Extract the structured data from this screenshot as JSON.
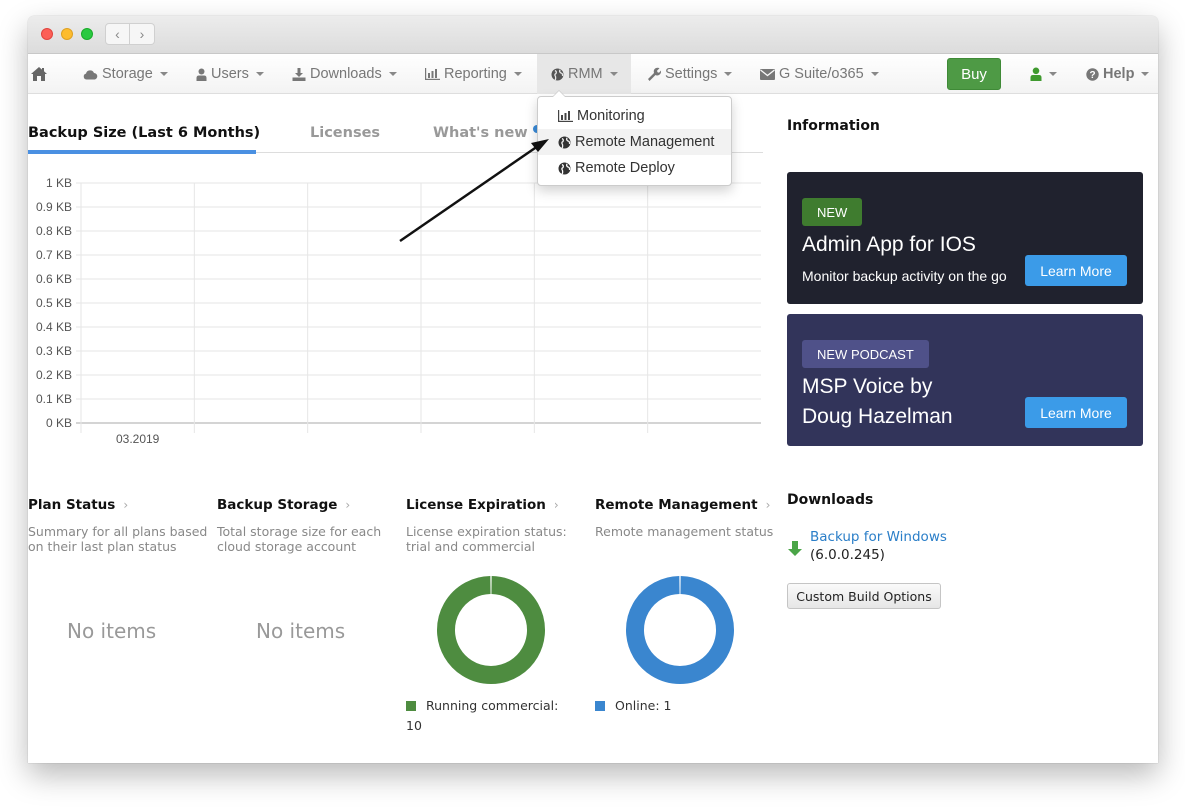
{
  "window": {
    "controls": [
      "close",
      "minimize",
      "maximize"
    ],
    "back_icon": "‹",
    "forward_icon": "›"
  },
  "nav": {
    "home_icon": "home-icon",
    "items": [
      {
        "label": "Storage",
        "icon": "cloud-icon"
      },
      {
        "label": "Users",
        "icon": "user-icon"
      },
      {
        "label": "Downloads",
        "icon": "download-icon"
      },
      {
        "label": "Reporting",
        "icon": "bar-chart-icon"
      },
      {
        "label": "RMM",
        "icon": "globe-icon",
        "active": true
      },
      {
        "label": "Settings",
        "icon": "wrench-icon"
      },
      {
        "label": "G Suite/o365",
        "icon": "envelope-icon"
      }
    ],
    "buy_label": "Buy",
    "account_icon": "user-icon",
    "help_label": "Help",
    "colors": {
      "buy": "#4e9a45",
      "account": "#3f9a2f"
    }
  },
  "rmm_dropdown": {
    "items": [
      {
        "label": "Monitoring",
        "icon": "bar-chart-icon"
      },
      {
        "label": "Remote Management",
        "icon": "globe-icon",
        "highlighted": true
      },
      {
        "label": "Remote Deploy",
        "icon": "globe-icon"
      }
    ]
  },
  "tabs": [
    {
      "label": "Backup Size (Last 6 Months)",
      "active": true
    },
    {
      "label": "Licenses",
      "active": false
    },
    {
      "label": "What's new",
      "active": false,
      "has_dot": true
    }
  ],
  "chart_data": {
    "type": "bar",
    "title": "Backup Size (Last 6 Months)",
    "xlabel": "",
    "ylabel": "",
    "categories": [
      "03.2019",
      "",
      "",
      "",
      "",
      ""
    ],
    "values": [
      0,
      0,
      0,
      0,
      0,
      0
    ],
    "ylim": [
      0,
      1
    ],
    "yunit": "KB",
    "yticks": [
      "0 KB",
      "0.1 KB",
      "0.2 KB",
      "0.3 KB",
      "0.4 KB",
      "0.5 KB",
      "0.6 KB",
      "0.7 KB",
      "0.8 KB",
      "0.9 KB",
      "1 KB"
    ],
    "grid": true
  },
  "widgets": [
    {
      "title": "Plan Status",
      "desc": "Summary for all plans based on their last plan status",
      "empty_text": "No items"
    },
    {
      "title": "Backup Storage",
      "desc": "Total storage size for each cloud storage account",
      "empty_text": "No items"
    },
    {
      "title": "License Expiration",
      "desc": "License expiration status: trial and commercial",
      "donut": {
        "type": "pie",
        "slices": [
          {
            "label": "Running commercial",
            "value": 10,
            "color": "#4e8c40"
          }
        ]
      },
      "legend": "Running commercial:",
      "legend_value": "10"
    },
    {
      "title": "Remote Management",
      "desc": "Remote management status",
      "donut": {
        "type": "pie",
        "slices": [
          {
            "label": "Online",
            "value": 1,
            "color": "#3a86cf"
          }
        ]
      },
      "legend": "Online: 1"
    }
  ],
  "information": {
    "title": "Information",
    "promos": [
      {
        "badge": "NEW",
        "headline": "Admin App for IOS",
        "sub": "Monitor backup activity on the go",
        "button": "Learn More"
      },
      {
        "badge": "NEW PODCAST",
        "headline_line1": "MSP Voice by",
        "headline_line2": "Doug Hazelman",
        "button": "Learn More"
      }
    ]
  },
  "downloads": {
    "title": "Downloads",
    "item_label": "Backup for Windows",
    "item_version": "(6.0.0.245)",
    "custom_build_label": "Custom Build Options"
  }
}
